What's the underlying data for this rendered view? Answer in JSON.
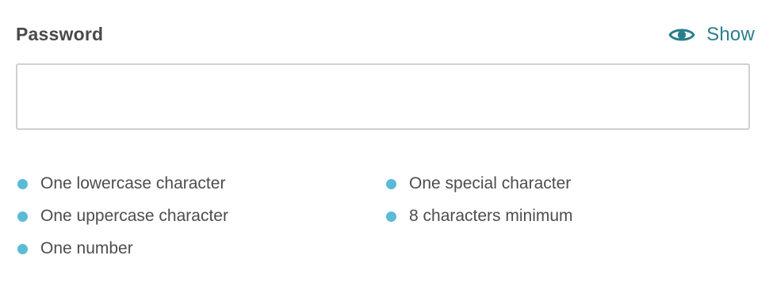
{
  "password_field": {
    "label": "Password",
    "value": "",
    "placeholder": "",
    "toggle": {
      "icon": "eye-icon",
      "label": "Show",
      "color": "#2a7f8c"
    }
  },
  "requirements": {
    "bullet_color": "#5bbad5",
    "left_column": [
      {
        "label": "One lowercase character"
      },
      {
        "label": "One uppercase character"
      },
      {
        "label": "One number"
      }
    ],
    "right_column": [
      {
        "label": "One special character"
      },
      {
        "label": "8 characters minimum"
      }
    ]
  }
}
